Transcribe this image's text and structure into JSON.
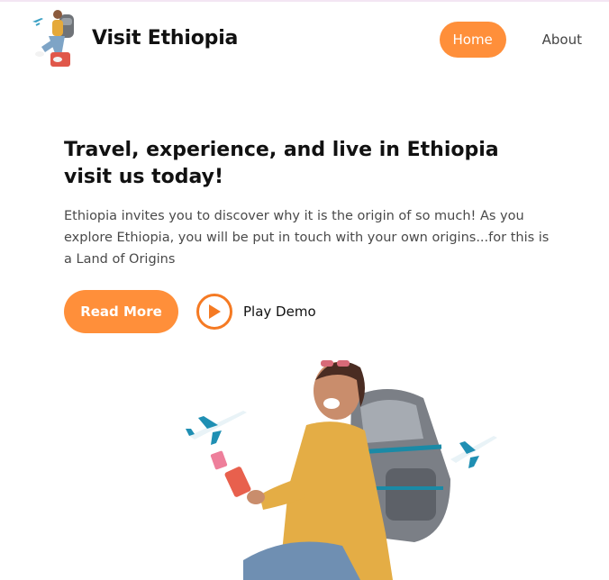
{
  "header": {
    "brand_title": "Visit Ethiopia",
    "nav": {
      "home": "Home",
      "about": "About"
    }
  },
  "hero": {
    "title": "Travel, experience, and live in Ethiopia visit us today!",
    "description": "Ethiopia invites you to discover why it is the origin of so much! As you explore Ethiopia, you will be put in touch with your own origins...for this is a Land of Origins",
    "read_more_label": "Read More",
    "play_demo_label": "Play Demo"
  },
  "colors": {
    "accent": "#ff8f3a",
    "play": "#f57a23"
  },
  "icons": {
    "play": "play-circle-icon",
    "logo": "traveler-logo",
    "illustration": "traveler-illustration"
  }
}
